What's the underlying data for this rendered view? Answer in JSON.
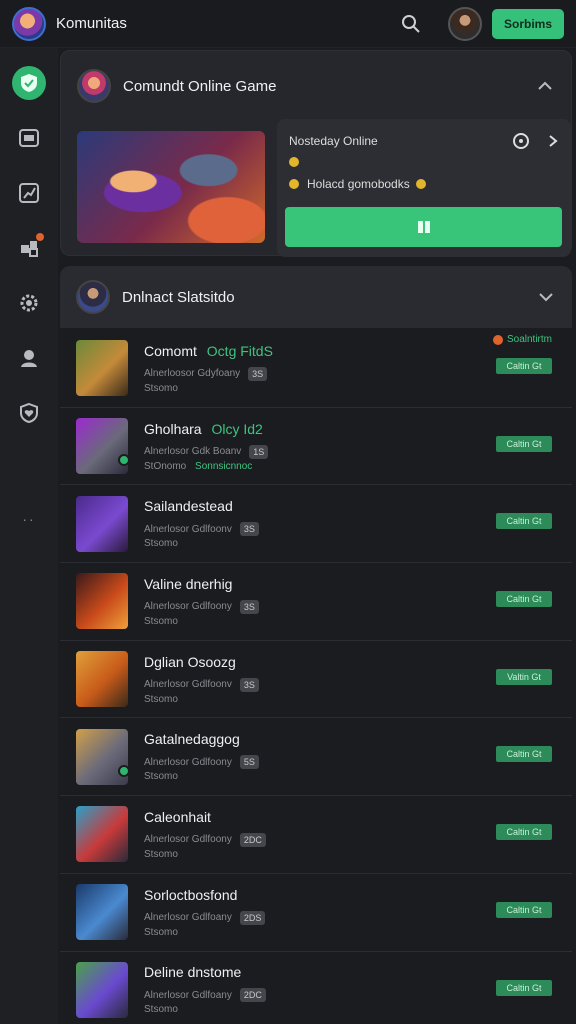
{
  "app": {
    "title": "Komunitas"
  },
  "header": {
    "primary_button": "Sorbims"
  },
  "featured": {
    "title": "Comundt Online Game",
    "panel_title": "Nosteday Online",
    "panel_line2": "Holacd gomobodks"
  },
  "section": {
    "title": "Dnlnact Slatsitdo"
  },
  "rows": [
    {
      "title": "Comomt",
      "highlight": "Octg FitdS",
      "meta": "Alnerloosor Gdyfoany",
      "pill": "3S",
      "sub": "Stsomo",
      "sub_hl": "",
      "btn": "Caltin Gt",
      "live": "Soalntirtm"
    },
    {
      "title": "Gholhara",
      "highlight": "Olcy Id2",
      "meta": "Alnerlosor Gdk Boanv",
      "pill": "1S",
      "sub": "StOnomo",
      "sub_hl": "Sonnsicnnoc",
      "btn": "Caltin Gt",
      "live": ""
    },
    {
      "title": "Sailandestead",
      "highlight": "",
      "meta": "Alnerlosor Gdlfoonv",
      "pill": "3S",
      "sub": "Stsomo",
      "sub_hl": "",
      "btn": "Caltin Gt",
      "live": ""
    },
    {
      "title": "Valine dnerhig",
      "highlight": "",
      "meta": "Alnerlosor Gdlfoony",
      "pill": "3S",
      "sub": "Stsomo",
      "sub_hl": "",
      "btn": "Caltin Gt",
      "live": ""
    },
    {
      "title": "Dglian Osoozg",
      "highlight": "",
      "meta": "Alnerlosor Gdlfoonv",
      "pill": "3S",
      "sub": "Stsomo",
      "sub_hl": "",
      "btn": "Valtin Gt",
      "live": ""
    },
    {
      "title": "Gatalnedaggog",
      "highlight": "",
      "meta": "Alnerlosor Gdlfoony",
      "pill": "5S",
      "sub": "Stsomo",
      "sub_hl": "",
      "btn": "Caltin Gt",
      "live": ""
    },
    {
      "title": "Caleonhait",
      "highlight": "",
      "meta": "Alnerlosor Gdlfoony",
      "pill": "2DC",
      "sub": "Stsomo",
      "sub_hl": "",
      "btn": "Caltin Gt",
      "live": ""
    },
    {
      "title": "Sorloctbosfond",
      "highlight": "",
      "meta": "Alnerlosor Gdlfoany",
      "pill": "2DS",
      "sub": "Stsomo",
      "sub_hl": "",
      "btn": "Caltin Gt",
      "live": ""
    },
    {
      "title": "Deline dnstome",
      "highlight": "",
      "meta": "Alnerlosor Gdlfoany",
      "pill": "2DC",
      "sub": "Stsomo",
      "sub_hl": "",
      "btn": "Caltin Gt",
      "live": ""
    }
  ],
  "icons": {
    "rail": [
      "shield-icon",
      "inbox-icon",
      "chart-icon",
      "puzzle-icon",
      "gear-icon",
      "user-icon",
      "heart-shield-icon"
    ]
  },
  "colors": {
    "accent": "#35c17a",
    "background": "#1b1c20",
    "card": "#26272c"
  }
}
